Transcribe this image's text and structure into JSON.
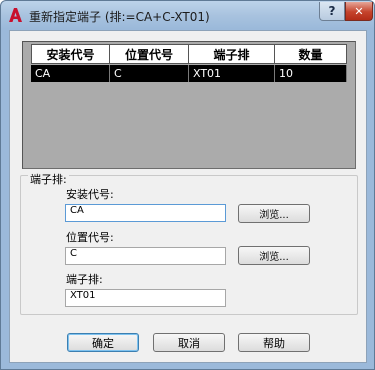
{
  "window": {
    "title": "重新指定端子 (排:=CA+C-XT01)",
    "help_glyph": "?",
    "close_glyph": "✕",
    "accent_color": "#c5432c",
    "app_icon": "autocad-a-icon"
  },
  "list": {
    "headers": [
      "安装代号",
      "位置代号",
      "端子排",
      "数量"
    ],
    "rows": [
      [
        "CA",
        "C",
        "XT01",
        "10"
      ]
    ]
  },
  "group": {
    "label": "端子排:",
    "install_label": "安装代号:",
    "install_value": "CA",
    "location_label": "位置代号:",
    "location_value": "C",
    "terminal_label": "端子排:",
    "terminal_value": "XT01",
    "browse1_label": "浏览...",
    "browse2_label": "浏览..."
  },
  "footer": {
    "ok_label": "确定",
    "cancel_label": "取消",
    "help_label": "帮助"
  }
}
